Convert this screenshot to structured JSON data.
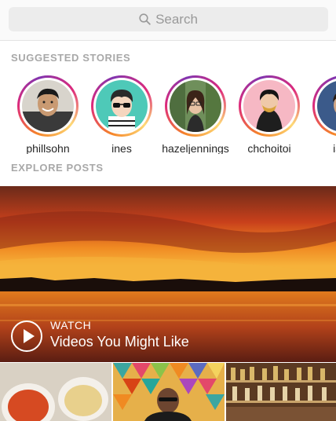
{
  "search": {
    "placeholder": "Search",
    "icon": "search-icon"
  },
  "sections": {
    "suggested_stories": "SUGGESTED STORIES",
    "explore_posts": "EXPLORE POSTS"
  },
  "stories": [
    {
      "username": "phillsohn"
    },
    {
      "username": "ines"
    },
    {
      "username": "hazeljennings"
    },
    {
      "username": "chchoitoi"
    },
    {
      "username": "ians"
    }
  ],
  "hero": {
    "label": "WATCH",
    "title": "Videos You Might Like",
    "icon": "play-icon"
  },
  "colors": {
    "ring_start": "#f58529",
    "ring_mid": "#dd2a7b",
    "ring_end": "#8134af",
    "label_gray": "#a8a8a8"
  }
}
